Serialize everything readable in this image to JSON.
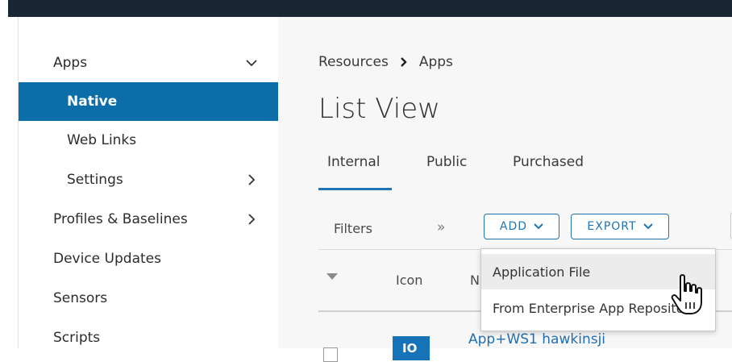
{
  "sidebar": {
    "items": [
      {
        "label": "Apps",
        "expanded": true
      },
      {
        "label": "Native",
        "active": true
      },
      {
        "label": "Web Links"
      },
      {
        "label": "Settings"
      },
      {
        "label": "Profiles & Baselines"
      },
      {
        "label": "Device Updates"
      },
      {
        "label": "Sensors"
      },
      {
        "label": "Scripts"
      }
    ]
  },
  "main": {
    "breadcrumb": [
      "Resources",
      "Apps"
    ],
    "title": "List View",
    "tabs": [
      {
        "label": "Internal",
        "active": true
      },
      {
        "label": "Public"
      },
      {
        "label": "Purchased"
      }
    ],
    "toolbar": {
      "filters_label": "Filters",
      "expand_glyph": "»",
      "add_label": "ADD",
      "export_label": "EXPORT"
    },
    "table": {
      "columns": [
        "Icon",
        "N"
      ],
      "rows": [
        {
          "icon_text": "IO",
          "name": "App+WS1 hawkinsji"
        }
      ]
    }
  },
  "dropdown": {
    "items": [
      {
        "label": "Application File",
        "hovered": true
      },
      {
        "label": "From Enterprise App Reposito"
      }
    ]
  },
  "colors": {
    "topbar": "#1a2733",
    "active_nav": "#0b6ea8",
    "accent": "#1f74b5",
    "link": "#1f6fb3"
  }
}
